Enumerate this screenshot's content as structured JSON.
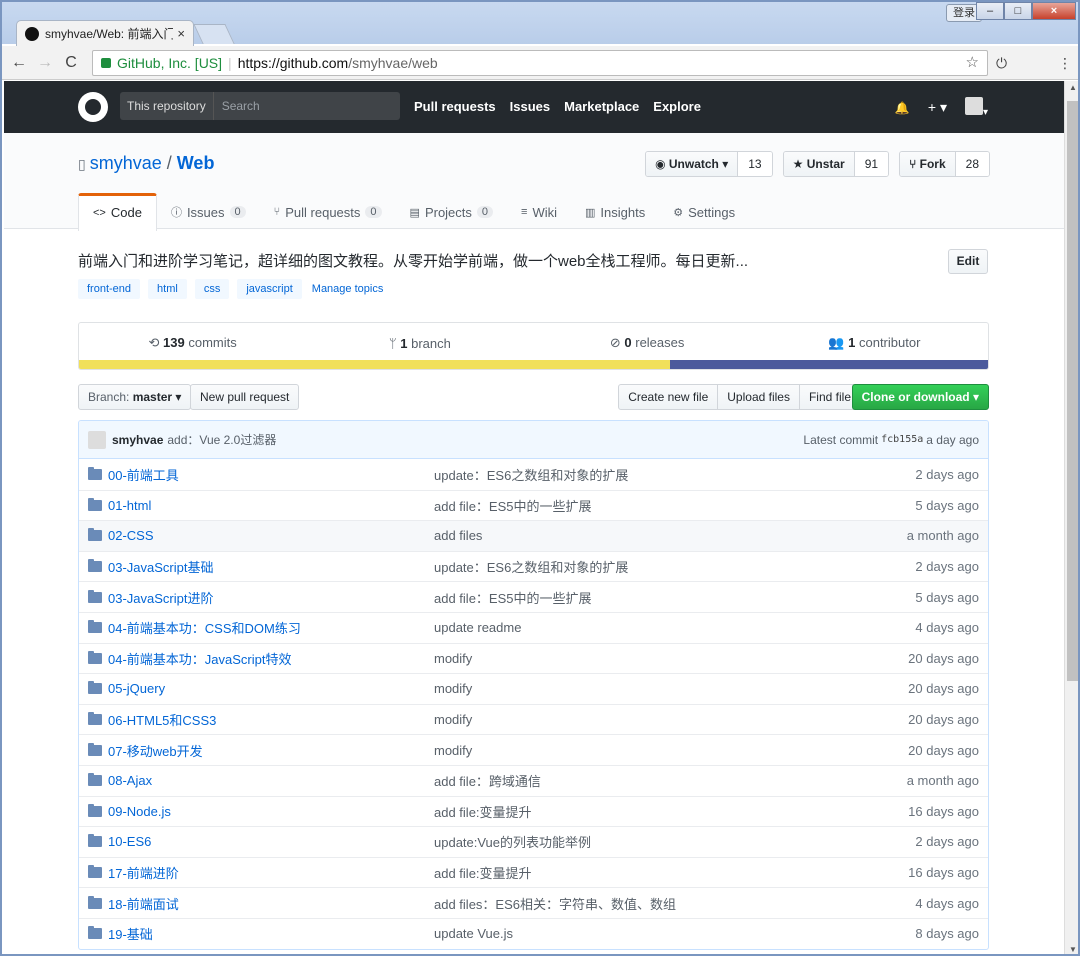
{
  "browser": {
    "tab_title": "smyhvae/Web: 前端入门",
    "tab_close": "×",
    "profile_label": "登录",
    "win_min": "–",
    "win_max": "□",
    "win_close": "×",
    "back": "←",
    "forward": "→",
    "reload": "C",
    "secure_label": "GitHub, Inc. [US]",
    "url_host": "https://github.com",
    "url_path": "/smyhvae/web",
    "star": "☆",
    "power_icon": "⏻",
    "menu_icon": "⋮"
  },
  "header": {
    "scope": "This repository",
    "search_placeholder": "Search",
    "nav": [
      "Pull requests",
      "Issues",
      "Marketplace",
      "Explore"
    ],
    "bell": "🔔",
    "plus": "+ ▾",
    "avatar_caret": "▾"
  },
  "repo": {
    "owner": "smyhvae",
    "slash": " / ",
    "name": "Web",
    "watch_label": "Unwatch ▾",
    "watch_count": "13",
    "star_label": "Unstar",
    "star_count": "91",
    "fork_label": "Fork",
    "fork_count": "28",
    "tabs": [
      {
        "label": "Code",
        "icon": "<>",
        "count": ""
      },
      {
        "label": "Issues",
        "icon": "ⓘ",
        "count": "0"
      },
      {
        "label": "Pull requests",
        "icon": "⑂",
        "count": "0"
      },
      {
        "label": "Projects",
        "icon": "▤",
        "count": "0"
      },
      {
        "label": "Wiki",
        "icon": "≡",
        "count": ""
      },
      {
        "label": "Insights",
        "icon": "▥",
        "count": ""
      },
      {
        "label": "Settings",
        "icon": "⚙",
        "count": ""
      }
    ],
    "description": "前端入门和进阶学习笔记，超详细的图文教程。从零开始学前端，做一个web全栈工程师。每日更新...",
    "edit_label": "Edit",
    "topics": [
      "front-end",
      "html",
      "css",
      "javascript"
    ],
    "manage_topics": "Manage topics"
  },
  "summary": {
    "commits_num": "139",
    "commits_label": " commits",
    "branch_num": "1",
    "branch_label": " branch",
    "releases_num": "0",
    "releases_label": " releases",
    "contrib_num": "1",
    "contrib_label": " contributor",
    "lang_colors": [
      "#f1e05a",
      "#4b5a9c"
    ],
    "lang_fractions": [
      0.65,
      0.35
    ]
  },
  "buttons": {
    "branch_prefix": "Branch: ",
    "branch_name": "master",
    "branch_caret": " ▾",
    "new_pr": "New pull request",
    "create_file": "Create new file",
    "upload": "Upload files",
    "find": "Find file",
    "clone": "Clone or download ▾"
  },
  "commit": {
    "author": "smyhvae",
    "message": "add：Vue 2.0过滤器",
    "latest_label": "Latest commit",
    "sha": "fcb155a",
    "age": "a day ago"
  },
  "files": [
    {
      "name": "00-前端工具",
      "msg": "update：ES6之数组和对象的扩展",
      "age": "2 days ago"
    },
    {
      "name": "01-html",
      "msg": "add file：ES5中的一些扩展",
      "age": "5 days ago"
    },
    {
      "name": "02-CSS",
      "msg": "add files",
      "age": "a month ago"
    },
    {
      "name": "03-JavaScript基础",
      "msg": "update：ES6之数组和对象的扩展",
      "age": "2 days ago"
    },
    {
      "name": "03-JavaScript进阶",
      "msg": "add file：ES5中的一些扩展",
      "age": "5 days ago"
    },
    {
      "name": "04-前端基本功：CSS和DOM练习",
      "msg": "update readme",
      "age": "4 days ago"
    },
    {
      "name": "04-前端基本功：JavaScript特效",
      "msg": "modify",
      "age": "20 days ago"
    },
    {
      "name": "05-jQuery",
      "msg": "modify",
      "age": "20 days ago"
    },
    {
      "name": "06-HTML5和CSS3",
      "msg": "modify",
      "age": "20 days ago"
    },
    {
      "name": "07-移动web开发",
      "msg": "modify",
      "age": "20 days ago"
    },
    {
      "name": "08-Ajax",
      "msg": "add file：跨域通信",
      "age": "a month ago"
    },
    {
      "name": "09-Node.js",
      "msg": "add file:变量提升",
      "age": "16 days ago"
    },
    {
      "name": "10-ES6",
      "msg": "update:Vue的列表功能举例",
      "age": "2 days ago"
    },
    {
      "name": "17-前端进阶",
      "msg": "add file:变量提升",
      "age": "16 days ago"
    },
    {
      "name": "18-前端面试",
      "msg": "add files：ES6相关：字符串、数值、数组",
      "age": "4 days ago"
    },
    {
      "name": "19-基础",
      "msg": "update Vue.js",
      "age": "8 days ago"
    }
  ]
}
